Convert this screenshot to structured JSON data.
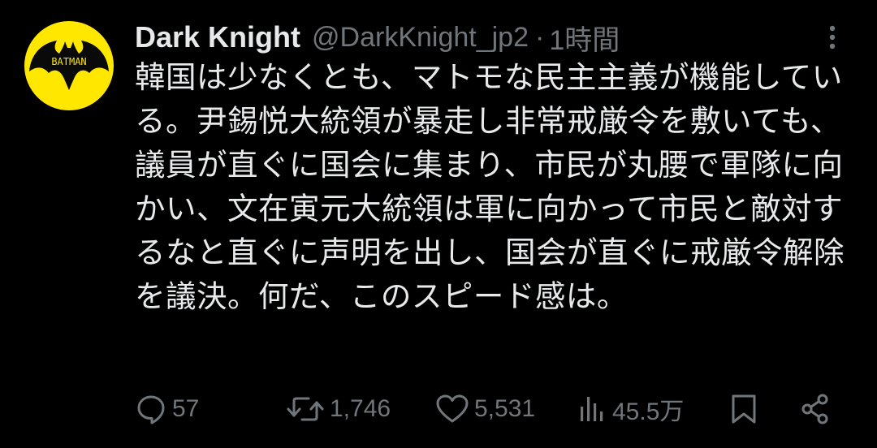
{
  "tweet": {
    "author": {
      "display_name": "Dark Knight",
      "handle": "@DarkKnight_jp2",
      "separator": "·",
      "timestamp": "1時間",
      "avatar_text": "BATMAN"
    },
    "text": "韓国は少なくとも、マトモな民主主義が機能している。尹錫悦大統領が暴走し非常戒厳令を敷いても、議員が直ぐに国会に集まり、市民が丸腰で軍隊に向かい、文在寅元大統領は軍に向かって市民と敵対するなと直ぐに声明を出し、国会が直ぐに戒厳令解除を議決。何だ、このスピード感は。",
    "actions": {
      "replies": "57",
      "reposts": "1,746",
      "likes": "5,531",
      "views": "45.5万"
    }
  },
  "icons": {
    "more": "more-vertical-icon",
    "reply": "reply-icon",
    "repost": "repost-icon",
    "like": "heart-icon",
    "views": "views-icon",
    "bookmark": "bookmark-icon",
    "share": "share-icon"
  },
  "colors": {
    "background": "#000000",
    "primary_text": "#e7e9ea",
    "secondary_text": "#71767b",
    "avatar_background": "#ffe700"
  }
}
